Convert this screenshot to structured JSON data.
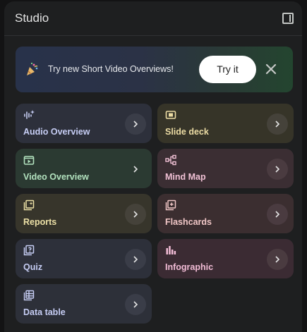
{
  "header": {
    "title": "Studio",
    "panel_icon": "dock-to-right-icon"
  },
  "banner": {
    "icon": "party-popper-icon",
    "text": "Try new Short Video Overviews!",
    "try_label": "Try it",
    "close_icon": "close-icon"
  },
  "tiles": [
    {
      "label": "Audio Overview",
      "icon": "audio-waveform-icon"
    },
    {
      "label": "Slide deck",
      "icon": "slides-icon"
    },
    {
      "label": "Video Overview",
      "icon": "video-icon"
    },
    {
      "label": "Mind Map",
      "icon": "mind-map-icon"
    },
    {
      "label": "Reports",
      "icon": "reports-icon"
    },
    {
      "label": "Flashcards",
      "icon": "flashcards-icon"
    },
    {
      "label": "Quiz",
      "icon": "quiz-icon"
    },
    {
      "label": "Infographic",
      "icon": "infographic-icon"
    },
    {
      "label": "Data table",
      "icon": "data-table-icon"
    }
  ],
  "colors": {
    "panel_bg": "#1e1f20",
    "page_bg": "#131314",
    "audio_tile": "#2d303b",
    "slide_tile": "#363428",
    "video_tile": "#2b3a32",
    "mind_tile": "#3b2e33"
  }
}
